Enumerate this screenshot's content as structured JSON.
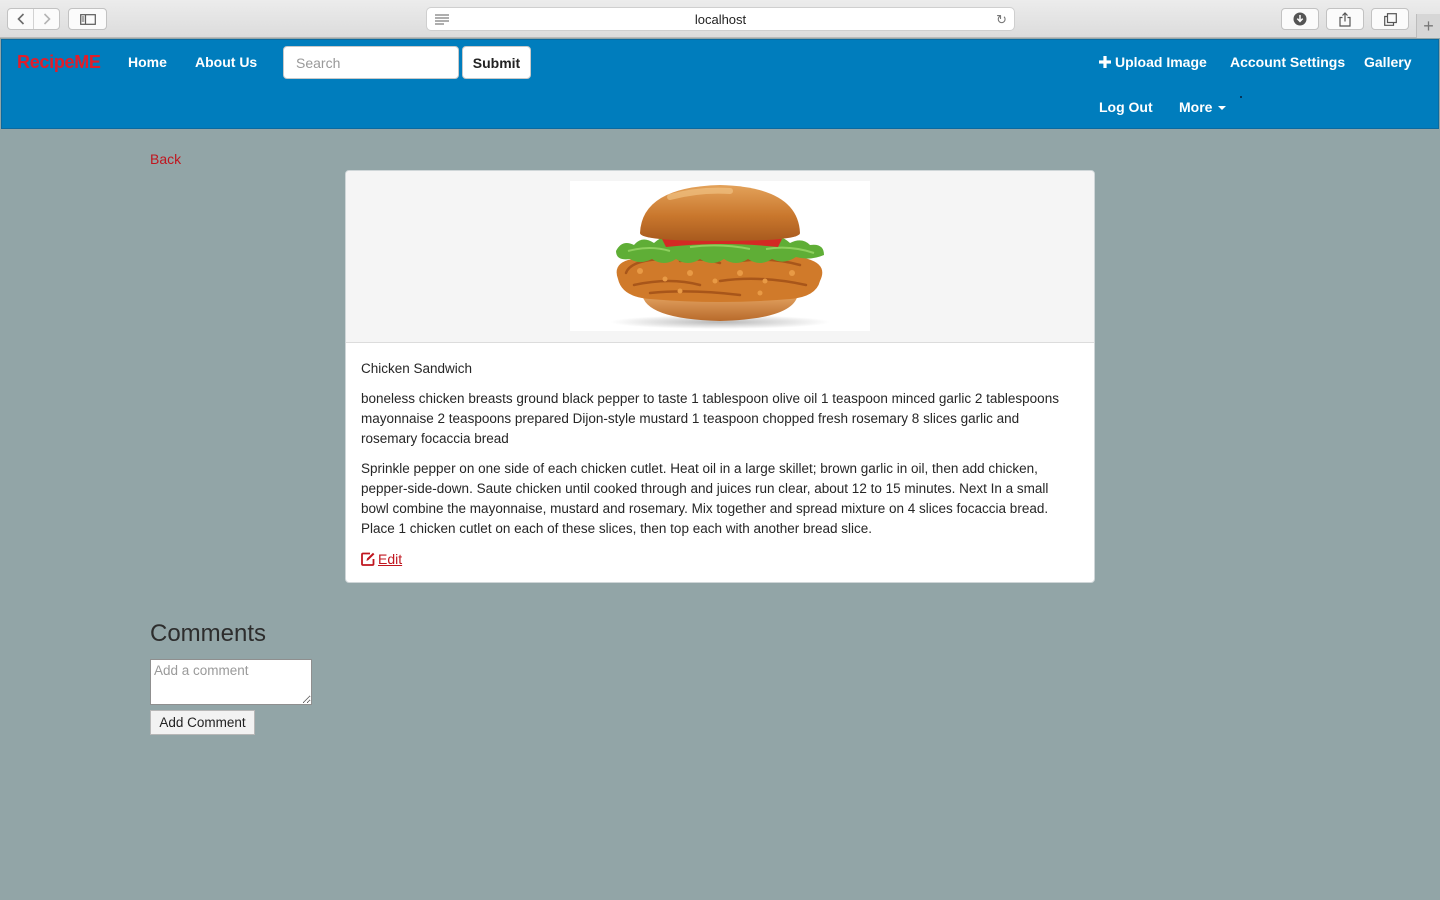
{
  "browser": {
    "url": "localhost"
  },
  "navbar": {
    "brand": "RecipeME",
    "links": [
      "Home",
      "About Us"
    ],
    "search": {
      "placeholder": "Search",
      "value": ""
    },
    "submit_label": "Submit",
    "right_links": [
      "Upload Image",
      "Account Settings",
      "Gallery"
    ],
    "logout_label": "Log Out",
    "more_label": "More"
  },
  "page": {
    "back_label": "Back",
    "recipe": {
      "title": "Chicken Sandwich",
      "ingredients": "boneless chicken breasts ground black pepper to taste 1 tablespoon olive oil 1 teaspoon minced garlic 2 tablespoons mayonnaise 2 teaspoons prepared Dijon-style mustard 1 teaspoon chopped fresh rosemary 8 slices garlic and rosemary focaccia bread",
      "directions": "Sprinkle pepper on one side of each chicken cutlet. Heat oil in a large skillet; brown garlic in oil, then add chicken, pepper-side-down. Saute chicken until cooked through and juices run clear, about 12 to 15 minutes. Next In a small bowl combine the mayonnaise, mustard and rosemary. Mix together and spread mixture on 4 slices focaccia bread. Place 1 chicken cutlet on each of these slices, then top each with another bread slice.",
      "edit_label": "Edit"
    },
    "comments": {
      "heading": "Comments",
      "placeholder": "Add a comment",
      "button_label": "Add Comment"
    }
  },
  "colors": {
    "navbar": "#007dbd",
    "brand": "#e11d2a",
    "link_red": "#c0161f",
    "page_bg": "#92a5a7"
  },
  "icons": {
    "upload": "plus-icon",
    "edit": "edit-icon",
    "more": "caret-down-icon"
  }
}
